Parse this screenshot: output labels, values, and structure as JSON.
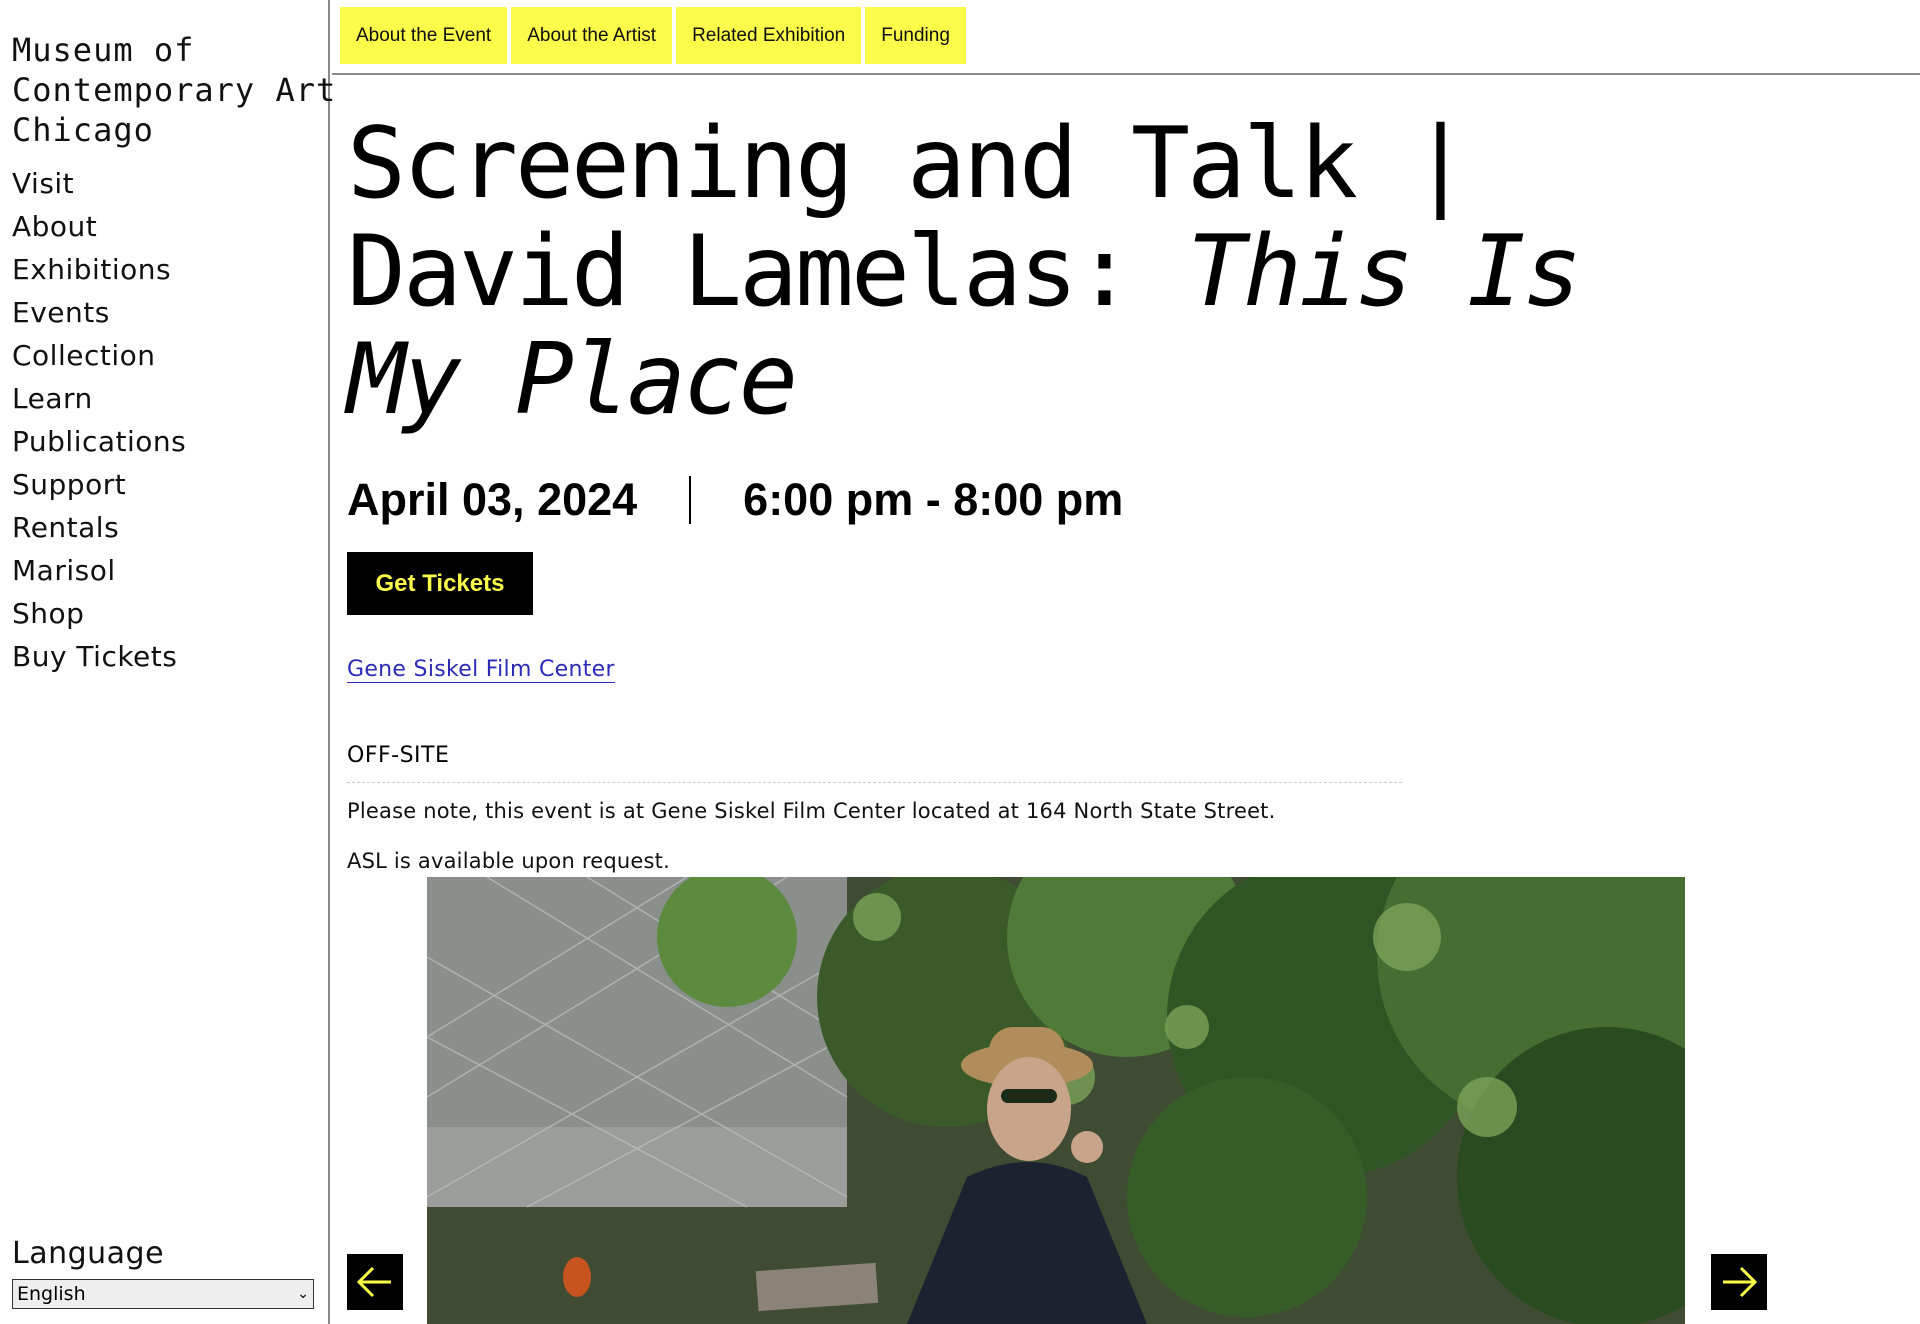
{
  "sidebar": {
    "logo_lines": [
      "Museum of",
      "Contemporary Art",
      "Chicago"
    ],
    "nav": [
      "Visit",
      "About",
      "Exhibitions",
      "Events",
      "Collection",
      "Learn",
      "Publications",
      "Support",
      "Rentals",
      "Marisol",
      "Shop",
      "Buy Tickets"
    ],
    "language_label": "Language",
    "language_value": "English"
  },
  "tabs": [
    "About the Event",
    "About the Artist",
    "Related Exhibition",
    "Funding"
  ],
  "event": {
    "title_plain": "Screening and Talk | David Lamelas:",
    "title_italic": "This Is My Place",
    "date": "April 03, 2024",
    "time": "6:00 pm - 8:00 pm",
    "tickets_label": "Get Tickets",
    "venue": "Gene Siskel Film Center",
    "tag": "OFF-SITE",
    "note": "Please note, this event is at Gene Siskel Film Center located at 164 North State Street.",
    "note2": "ASL is available upon request."
  },
  "colors": {
    "accent": "#fbfb4a",
    "link": "#2b2bb8"
  },
  "icons": {
    "prev": "arrow-left-icon",
    "next": "arrow-right-icon"
  }
}
